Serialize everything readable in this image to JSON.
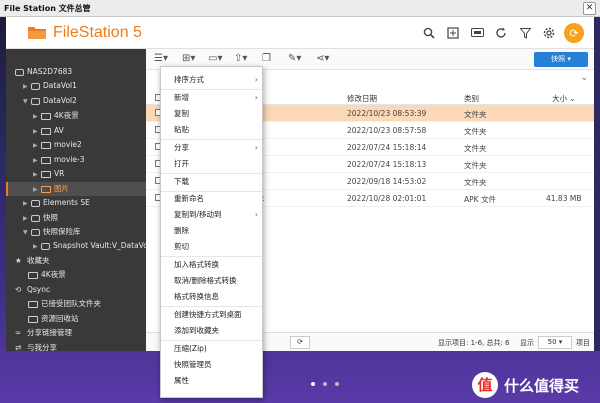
{
  "window": {
    "title": "File Station 文件总管",
    "close": "✕"
  },
  "app": {
    "brand": "FileStation 5"
  },
  "header_icons": [
    "search-icon",
    "upload-icon",
    "display-icon",
    "refresh-icon",
    "filter-icon",
    "settings-icon",
    "qfile-icon"
  ],
  "sidebar": {
    "items": [
      {
        "label": "NAS2D7683",
        "arrow": "",
        "icon": "device"
      },
      {
        "label": "DataVol1",
        "arrow": "▶",
        "icon": "drive"
      },
      {
        "label": "DataVol2",
        "arrow": "▼",
        "icon": "drive"
      },
      {
        "label": "4K夜景",
        "arrow": "▶",
        "icon": "folder"
      },
      {
        "label": "AV",
        "arrow": "▶",
        "icon": "folder"
      },
      {
        "label": "movie2",
        "arrow": "▶",
        "icon": "folder"
      },
      {
        "label": "movie-3",
        "arrow": "▶",
        "icon": "folder"
      },
      {
        "label": "VR",
        "arrow": "▶",
        "icon": "folder"
      },
      {
        "label": "图片",
        "arrow": "▶",
        "icon": "folder"
      },
      {
        "label": "Elements SE",
        "arrow": "▶",
        "icon": "drive"
      },
      {
        "label": "快照",
        "arrow": "▶",
        "icon": "drive"
      },
      {
        "label": "快照保险库",
        "arrow": "▼",
        "icon": "drive"
      },
      {
        "label": "Snapshot Vault:V_DataVol1",
        "arrow": "▶",
        "icon": "drive"
      },
      {
        "label": "收藏夹",
        "arrow": "",
        "icon": "star"
      },
      {
        "label": "4K夜景",
        "arrow": "",
        "icon": "folder"
      },
      {
        "label": "Qsync",
        "arrow": "",
        "icon": "sync"
      },
      {
        "label": "已接受团队文件夹",
        "arrow": "",
        "icon": "folder"
      },
      {
        "label": "资源回收站",
        "arrow": "",
        "icon": "folder"
      },
      {
        "label": "分享链接管理",
        "arrow": "",
        "icon": "link"
      },
      {
        "label": "与我分享",
        "arrow": "",
        "icon": "share"
      }
    ]
  },
  "toolbar": {
    "quick_label": "快照 ▾"
  },
  "table": {
    "headers": {
      "modified": "修改日期",
      "type": "类别",
      "size": "大小 ⌄"
    },
    "rows": [
      {
        "date": "2022/10/23 08:53:39",
        "type": "文件夹",
        "size": "",
        "name_suffix": ""
      },
      {
        "date": "2022/10/23 08:57:58",
        "type": "文件夹",
        "size": "",
        "name_suffix": ""
      },
      {
        "date": "2022/07/24 15:18:14",
        "type": "文件夹",
        "size": "",
        "name_suffix": ""
      },
      {
        "date": "2022/07/24 15:18:13",
        "type": "文件夹",
        "size": "",
        "name_suffix": ""
      },
      {
        "date": "2022/09/18 14:53:02",
        "type": "文件夹",
        "size": "",
        "name_suffix": ""
      },
      {
        "date": "2022/10/28 02:01:01",
        "type": "APK 文件",
        "size": "41.83 MB",
        "name_suffix": "k"
      }
    ]
  },
  "footer": {
    "display_items": "显示项目: 1-6, 总共: 6",
    "display_label": "显示",
    "per_page": "50",
    "items_label": "项目"
  },
  "context_menu": {
    "items": [
      {
        "label": "排序方式",
        "sub": "›"
      },
      {
        "label": "新增",
        "sub": "›"
      },
      {
        "label": "复制",
        "sub": ""
      },
      {
        "label": "粘贴",
        "sub": ""
      },
      {
        "label": "分享",
        "sub": "›"
      },
      {
        "label": "打开",
        "sub": ""
      },
      {
        "label": "下载",
        "sub": ""
      },
      {
        "label": "重新命名",
        "sub": ""
      },
      {
        "label": "复制到/移动到",
        "sub": "›"
      },
      {
        "label": "删除",
        "sub": ""
      },
      {
        "label": "剪切",
        "sub": ""
      },
      {
        "label": "加入格式转换",
        "sub": ""
      },
      {
        "label": "取消/删除格式转换",
        "sub": ""
      },
      {
        "label": "格式转换信息",
        "sub": ""
      },
      {
        "label": "创建快捷方式到桌面",
        "sub": ""
      },
      {
        "label": "添加到收藏夹",
        "sub": ""
      },
      {
        "label": "压缩(Zip)",
        "sub": ""
      },
      {
        "label": "快照管理员",
        "sub": ""
      },
      {
        "label": "属性",
        "sub": ""
      }
    ]
  },
  "watermark": {
    "badge": "值",
    "text": "什么值得买"
  }
}
